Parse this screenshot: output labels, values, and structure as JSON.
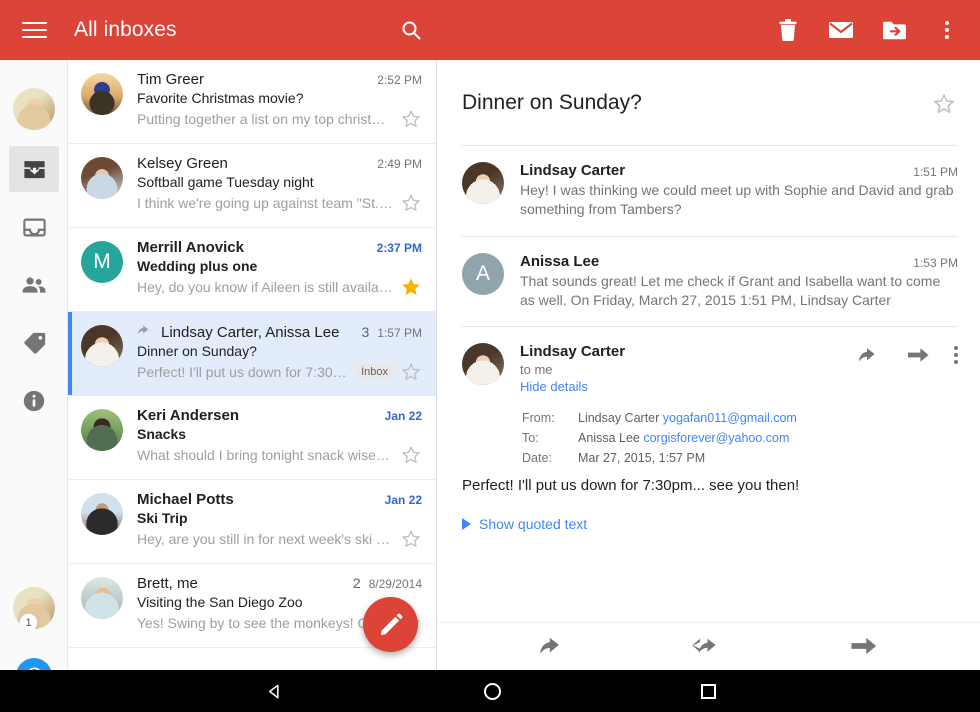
{
  "appbar": {
    "title": "All inboxes",
    "menu_icon": "hamburger-menu-icon",
    "search_icon": "search-icon",
    "actions": [
      {
        "name": "delete-button",
        "icon": "trash-icon"
      },
      {
        "name": "mark-unread-button",
        "icon": "envelope-icon"
      },
      {
        "name": "move-to-folder-button",
        "icon": "folder-move-icon"
      },
      {
        "name": "overflow-menu-button",
        "icon": "more-vert-icon"
      }
    ]
  },
  "rail": {
    "items": [
      {
        "name": "account-avatar-primary",
        "icon": "avatar-photo",
        "selected": false
      },
      {
        "name": "all-inboxes",
        "icon": "all-inboxes-icon",
        "selected": true
      },
      {
        "name": "inbox",
        "icon": "inbox-icon",
        "selected": false
      },
      {
        "name": "social",
        "icon": "people-icon",
        "selected": false
      },
      {
        "name": "promotions",
        "icon": "label-tag-icon",
        "selected": false
      },
      {
        "name": "updates",
        "icon": "info-icon",
        "selected": false
      }
    ],
    "account_switcher": {
      "name": "account-avatar-secondary",
      "badge": "1"
    },
    "account_letter": {
      "name": "account-avatar-tertiary",
      "letter": "C",
      "color": "#2196f3"
    }
  },
  "list": {
    "emails": [
      {
        "avatar_type": "photo",
        "avatar_class": "ph-tim",
        "sender": "Tim Greer",
        "count": "",
        "time": "2:52 PM",
        "subject": "Favorite Christmas movie?",
        "snippet": "Putting together a list on my top christmas…",
        "unread": false,
        "starred": false,
        "selected": false,
        "chip": "",
        "replied": false
      },
      {
        "avatar_type": "photo",
        "avatar_class": "ph-kelsey",
        "sender": "Kelsey Green",
        "count": "",
        "time": "2:49 PM",
        "subject": "Softball game Tuesday night",
        "snippet": "I think we're going up against team \"St. El…",
        "unread": false,
        "starred": false,
        "selected": false,
        "chip": "",
        "replied": false
      },
      {
        "avatar_type": "letter",
        "avatar_letter": "M",
        "avatar_color": "#26a69a",
        "sender": "Merrill Anovick",
        "count": "",
        "time": "2:37 PM",
        "subject": "Wedding plus one",
        "snippet": "Hey, do you know if Aileen is still available…",
        "unread": true,
        "starred": true,
        "selected": false,
        "chip": "",
        "replied": false
      },
      {
        "avatar_type": "photo",
        "avatar_class": "ph-lindsay",
        "sender": "Lindsay Carter, Anissa Lee",
        "count": "3",
        "time": "1:57 PM",
        "subject": "Dinner on Sunday?",
        "snippet": "Perfect! I'll put us down for 7:30pm….",
        "unread": false,
        "starred": false,
        "selected": true,
        "chip": "Inbox",
        "replied": true
      },
      {
        "avatar_type": "photo",
        "avatar_class": "ph-keri",
        "sender": "Keri Andersen",
        "count": "",
        "time": "Jan 22",
        "subject": "Snacks",
        "snippet": "What should I bring tonight snack wise? I t…",
        "unread": true,
        "starred": false,
        "selected": false,
        "chip": "",
        "replied": false
      },
      {
        "avatar_type": "photo",
        "avatar_class": "ph-michael",
        "sender": "Michael Potts",
        "count": "",
        "time": "Jan 22",
        "subject": "Ski Trip",
        "snippet": "Hey, are you still in for next week's ski trip?…",
        "unread": true,
        "starred": false,
        "selected": false,
        "chip": "",
        "replied": false
      },
      {
        "avatar_type": "photo",
        "avatar_class": "ph-brett",
        "sender": "Brett, me",
        "count": "2",
        "time": "8/29/2014",
        "subject": "Visiting the San Diego Zoo",
        "snippet": "Yes! Swing by to see the monkeys! On F",
        "unread": false,
        "starred": false,
        "selected": false,
        "chip": "",
        "replied": false
      }
    ],
    "compose_button": {
      "name": "compose-button",
      "icon": "pencil-icon",
      "color": "#db4437"
    }
  },
  "reading_pane": {
    "subject": "Dinner on Sunday?",
    "star_icon": "star-outline-icon",
    "messages": [
      {
        "avatar_type": "photo",
        "avatar_class": "ph-lindsay",
        "sender": "Lindsay Carter",
        "time": "1:51 PM",
        "preview": "Hey! I was thinking we could meet up with Sophie and David and grab something from Tambers?",
        "expanded": false
      },
      {
        "avatar_type": "letter",
        "avatar_letter": "A",
        "avatar_color": "#90a4ae",
        "sender": "Anissa Lee",
        "time": "1:53 PM",
        "preview": "That sounds great! Let me check if Grant and Isabella want to come as well. On Friday, March 27, 2015 1:51 PM, Lindsay Carter",
        "expanded": false
      }
    ],
    "open_message": {
      "avatar_type": "photo",
      "avatar_class": "ph-lindsay",
      "sender": "Lindsay Carter",
      "to_line": "to me",
      "details_toggle": "Hide details",
      "details": {
        "from_label": "From:",
        "from_name": "Lindsay Carter",
        "from_email": "yogafan011@gmail.com",
        "to_label": "To:",
        "to_name": "Anissa Lee",
        "to_email": "corgisforever@yahoo.com",
        "date_label": "Date:",
        "date_value": "Mar 27, 2015, 1:57 PM"
      },
      "body": "Perfect! I'll put us down for 7:30pm... see you then!",
      "show_quoted": "Show quoted text",
      "actions": [
        {
          "name": "reply-button",
          "icon": "reply-icon"
        },
        {
          "name": "forward-button",
          "icon": "forward-arrow-icon"
        },
        {
          "name": "message-overflow-button",
          "icon": "more-vert-icon"
        }
      ]
    },
    "footer_actions": [
      {
        "name": "reply-button",
        "icon": "reply-icon"
      },
      {
        "name": "reply-all-button",
        "icon": "reply-all-icon"
      },
      {
        "name": "forward-button",
        "icon": "forward-icon"
      }
    ]
  },
  "navbar": {
    "back": "back-triangle-icon",
    "home": "home-circle-icon",
    "recents": "recents-square-icon"
  }
}
